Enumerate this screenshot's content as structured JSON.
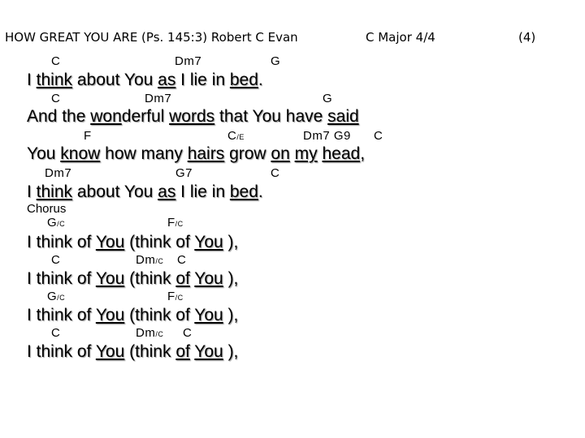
{
  "header": {
    "title": "HOW GREAT YOU ARE (Ps. 145:3) Robert C Evan",
    "key": "C Major 4/4",
    "page": "(4)"
  },
  "verse": [
    {
      "chords": [
        {
          "c": "C",
          "s": ""
        },
        {
          "c": "Dm7",
          "s": ""
        },
        {
          "c": "G",
          "s": ""
        }
      ],
      "lyric": [
        {
          "t": "I "
        },
        {
          "t": "think",
          "u": true
        },
        {
          "t": " about You "
        },
        {
          "t": "as",
          "u": true
        },
        {
          "t": " I lie in "
        },
        {
          "t": "bed",
          "u": true
        },
        {
          "t": "."
        }
      ]
    },
    {
      "chords": [
        {
          "c": "C",
          "s": ""
        },
        {
          "c": "Dm7",
          "s": ""
        },
        {
          "c": "G",
          "s": ""
        }
      ],
      "lyric": [
        {
          "t": "And the "
        },
        {
          "t": "won",
          "u": true
        },
        {
          "t": "derful "
        },
        {
          "t": "words",
          "u": true
        },
        {
          "t": " that You have "
        },
        {
          "t": "said",
          "u": true
        }
      ]
    },
    {
      "chords": [
        {
          "c": "F",
          "s": ""
        },
        {
          "c": "C",
          "s": "/E"
        },
        {
          "c": "Dm7 G9",
          "s": ""
        },
        {
          "c": "C",
          "s": ""
        }
      ],
      "lyric": [
        {
          "t": "You "
        },
        {
          "t": "know",
          "u": true
        },
        {
          "t": " how many "
        },
        {
          "t": "hairs",
          "u": true
        },
        {
          "t": " grow "
        },
        {
          "t": "on",
          "u": true
        },
        {
          "t": " "
        },
        {
          "t": "my",
          "u": true
        },
        {
          "t": " "
        },
        {
          "t": "head",
          "u": true
        },
        {
          "t": ","
        }
      ]
    },
    {
      "chords": [
        {
          "c": "Dm7",
          "s": ""
        },
        {
          "c": "G7",
          "s": ""
        },
        {
          "c": "C",
          "s": ""
        }
      ],
      "lyric": [
        {
          "t": "I "
        },
        {
          "t": "think",
          "u": true
        },
        {
          "t": " about You "
        },
        {
          "t": "as",
          "u": true
        },
        {
          "t": " I lie in "
        },
        {
          "t": "bed",
          "u": true
        },
        {
          "t": "."
        }
      ]
    }
  ],
  "chorus_label": "Chorus",
  "chorus": [
    {
      "chords": [
        {
          "c": "G",
          "s": "/C"
        },
        {
          "c": "F",
          "s": "/C"
        }
      ],
      "lyric": [
        {
          "t": "I think of "
        },
        {
          "t": "You",
          "u": true
        },
        {
          "t": " (think of "
        },
        {
          "t": "You",
          "u": true
        },
        {
          "t": " ),"
        }
      ]
    },
    {
      "chords": [
        {
          "c": "C",
          "s": ""
        },
        {
          "c": "Dm",
          "s": "/C"
        },
        {
          "c": "C",
          "s": ""
        }
      ],
      "lyric": [
        {
          "t": "I think of "
        },
        {
          "t": "You",
          "u": true
        },
        {
          "t": " (think "
        },
        {
          "t": "of",
          "u": true
        },
        {
          "t": " "
        },
        {
          "t": "You",
          "u": true
        },
        {
          "t": " ),"
        }
      ]
    },
    {
      "chords": [
        {
          "c": "G",
          "s": "/C"
        },
        {
          "c": "F",
          "s": "/C"
        }
      ],
      "lyric": [
        {
          "t": "I think of "
        },
        {
          "t": "You",
          "u": true
        },
        {
          "t": " (think of "
        },
        {
          "t": "You",
          "u": true
        },
        {
          "t": " ),"
        }
      ]
    },
    {
      "chords": [
        {
          "c": "C",
          "s": ""
        },
        {
          "c": "Dm",
          "s": "/C"
        },
        {
          "c": "C",
          "s": ""
        }
      ],
      "lyric": [
        {
          "t": "I think of "
        },
        {
          "t": "You",
          "u": true
        },
        {
          "t": " (think "
        },
        {
          "t": "of",
          "u": true
        },
        {
          "t": " "
        },
        {
          "t": "You",
          "u": true
        },
        {
          "t": " ),"
        }
      ]
    }
  ]
}
